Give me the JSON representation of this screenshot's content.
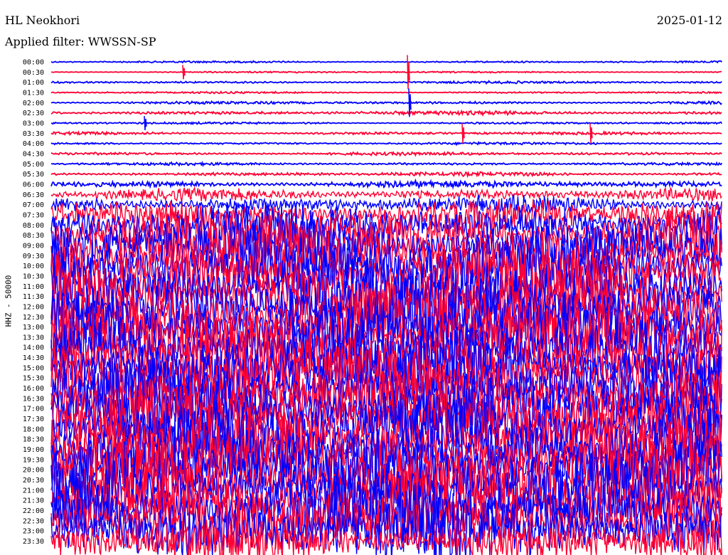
{
  "header": {
    "station": "HL Neokhori",
    "date": "2025-01-12",
    "filter": "Applied filter: WWSSN-SP",
    "channel_label": "HHZ - 50000"
  },
  "colors": {
    "trace_a": "#0000ff",
    "trace_b": "#ff0033",
    "background": "#ffffff",
    "text": "#000000"
  },
  "chart_data": {
    "type": "line",
    "title": "HL Neokhori",
    "subtitle": "Applied filter: WWSSN-SP",
    "ylabel": "HHZ - 50000",
    "xlabel": "",
    "grid": false,
    "legend": "none",
    "rows": [
      "00:00",
      "00:30",
      "01:00",
      "01:30",
      "02:00",
      "02:30",
      "03:00",
      "03:30",
      "04:00",
      "04:30",
      "05:00",
      "05:30",
      "06:00",
      "06:30",
      "07:00",
      "07:30",
      "08:00",
      "08:30",
      "09:00",
      "09:30",
      "10:00",
      "10:30",
      "11:00",
      "11:30",
      "12:00",
      "12:30",
      "13:00",
      "13:30",
      "14:00",
      "14:30",
      "15:00",
      "15:30",
      "16:00",
      "16:30",
      "17:00",
      "17:30",
      "18:00",
      "18:30",
      "19:00",
      "19:30",
      "20:00",
      "20:30",
      "21:00",
      "21:30",
      "22:00",
      "22:30",
      "23:00",
      "23:30"
    ],
    "row_colors": [
      "#0000ff",
      "#ff0033"
    ],
    "relative_amplitude": [
      0.12,
      0.1,
      0.15,
      0.12,
      0.18,
      0.25,
      0.14,
      0.18,
      0.16,
      0.2,
      0.18,
      0.25,
      0.45,
      0.8,
      1.2,
      2.2,
      3.0,
      3.5,
      4.0,
      4.3,
      4.5,
      4.6,
      4.7,
      4.8,
      4.8,
      4.8,
      4.8,
      4.8,
      4.8,
      4.8,
      4.8,
      4.8,
      4.8,
      4.8,
      4.8,
      4.8,
      4.8,
      4.8,
      4.8,
      4.8,
      4.8,
      4.8,
      4.8,
      4.8,
      4.8,
      4.8,
      4.6,
      3.0
    ]
  }
}
